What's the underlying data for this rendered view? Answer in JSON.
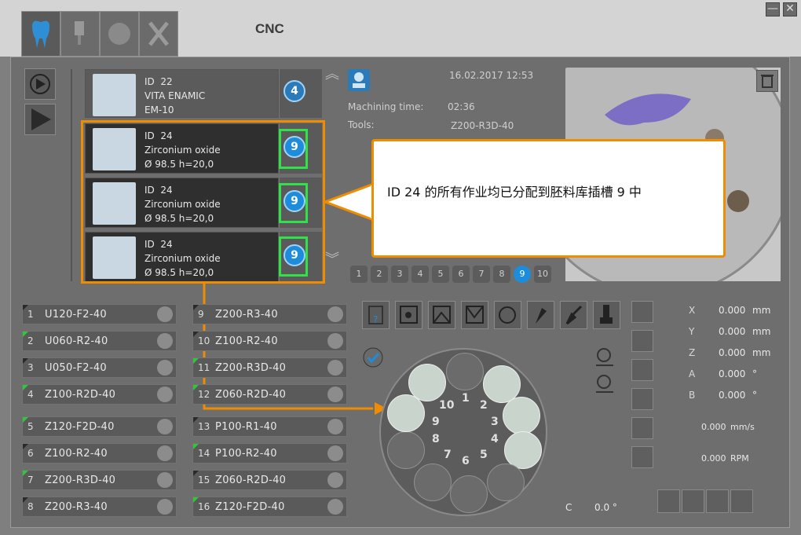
{
  "header": {
    "title": "CNC",
    "tabs": [
      "tooth-icon",
      "machine-icon",
      "milling-icon",
      "tools-icon"
    ],
    "window_buttons": [
      "minimize-icon",
      "close-icon"
    ]
  },
  "jobs": [
    {
      "id_label": "ID",
      "id": "22",
      "material": "VITA ENAMIC",
      "spec": "EM-10",
      "slot": "4"
    },
    {
      "id_label": "ID",
      "id": "24",
      "material": "Zirconium oxide",
      "spec": "Ø 98.5  h=20,0",
      "slot": "9"
    },
    {
      "id_label": "ID",
      "id": "24",
      "material": "Zirconium oxide",
      "spec": "Ø 98.5  h=20,0",
      "slot": "9"
    },
    {
      "id_label": "ID",
      "id": "24",
      "material": "Zirconium oxide",
      "spec": "Ø 98.5  h=20,0",
      "slot": "9"
    }
  ],
  "job_info": {
    "datetime": "16.02.2017 12:53",
    "machining_label": "Machining time:",
    "machining_value": "02:36",
    "tools_label": "Tools:",
    "tools_value": "Z200-R3D-40"
  },
  "slot_numbers": [
    "1",
    "2",
    "3",
    "4",
    "5",
    "6",
    "7",
    "8",
    "9",
    "10"
  ],
  "active_slot": "9",
  "tooltip": {
    "text": "ID 24 的所有作业均已分配到胚料库插槽 9 中"
  },
  "tools": [
    {
      "idx": "1",
      "name": "U120-F2-40",
      "flag": "none"
    },
    {
      "idx": "2",
      "name": "U060-R2-40",
      "flag": "green"
    },
    {
      "idx": "3",
      "name": "U050-F2-40",
      "flag": "none"
    },
    {
      "idx": "4",
      "name": "Z100-R2D-40",
      "flag": "green"
    },
    {
      "idx": "5",
      "name": "Z120-F2D-40",
      "flag": "green"
    },
    {
      "idx": "6",
      "name": "Z100-R2-40",
      "flag": "none"
    },
    {
      "idx": "7",
      "name": "Z200-R3D-40",
      "flag": "green"
    },
    {
      "idx": "8",
      "name": "Z200-R3-40",
      "flag": "none"
    },
    {
      "idx": "9",
      "name": "Z200-R3-40",
      "flag": "none"
    },
    {
      "idx": "10",
      "name": "Z100-R2-40",
      "flag": "none"
    },
    {
      "idx": "11",
      "name": "Z200-R3D-40",
      "flag": "green"
    },
    {
      "idx": "12",
      "name": "Z060-R2D-40",
      "flag": "green"
    },
    {
      "idx": "13",
      "name": "P100-R1-40",
      "flag": "none"
    },
    {
      "idx": "14",
      "name": "P100-R2-40",
      "flag": "green"
    },
    {
      "idx": "15",
      "name": "Z060-R2D-40",
      "flag": "none"
    },
    {
      "idx": "16",
      "name": "Z120-F2D-40",
      "flag": "green"
    }
  ],
  "axes": [
    {
      "label": "X",
      "value": "0.000",
      "unit": "mm"
    },
    {
      "label": "Y",
      "value": "0.000",
      "unit": "mm"
    },
    {
      "label": "Z",
      "value": "0.000",
      "unit": "mm"
    },
    {
      "label": "A",
      "value": "0.000",
      "unit": "°"
    },
    {
      "label": "B",
      "value": "0.000",
      "unit": "°"
    }
  ],
  "feed": {
    "value": "0.000",
    "unit": "mm/s"
  },
  "spindle": {
    "value": "0.000",
    "unit": "RPM"
  },
  "c_axis": {
    "label": "C",
    "value": "0.0 °"
  },
  "magazine_numbers": [
    "1",
    "2",
    "3",
    "4",
    "5",
    "6",
    "7",
    "8",
    "9",
    "10"
  ],
  "colors": {
    "accent": "#f08c00",
    "highlight": "#32e04a",
    "slot_blue": "#1d8ddb"
  }
}
